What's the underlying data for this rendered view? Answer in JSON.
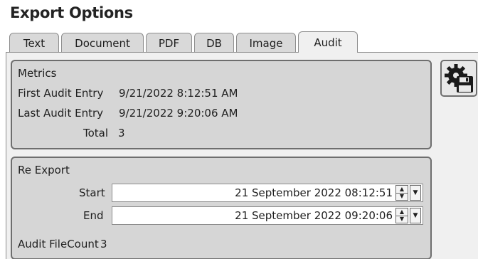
{
  "window": {
    "title": "Export Options"
  },
  "tabs": [
    {
      "label": "Text"
    },
    {
      "label": "Document"
    },
    {
      "label": "PDF"
    },
    {
      "label": "DB"
    },
    {
      "label": "Image"
    },
    {
      "label": "Audit"
    }
  ],
  "active_tab": "Audit",
  "metrics": {
    "heading": "Metrics",
    "first_entry_label": "First Audit Entry",
    "first_entry_value": "9/21/2022 8:12:51 AM",
    "last_entry_label": "Last Audit Entry",
    "last_entry_value": "9/21/2022 9:20:06 AM",
    "total_label": "Total",
    "total_value": "3"
  },
  "reexport": {
    "heading": "Re Export",
    "start_label": "Start",
    "start_value": "21 September 2022 08:12:51",
    "end_label": "End",
    "end_value": "21 September 2022 09:20:06",
    "filecount_label": "Audit FileCount",
    "filecount_value": "3"
  },
  "icons": {
    "export_settings": "gear-floppy-icon",
    "spin_up": "up-arrow-icon",
    "spin_down": "down-arrow-icon",
    "dropdown": "chevron-down-icon"
  }
}
